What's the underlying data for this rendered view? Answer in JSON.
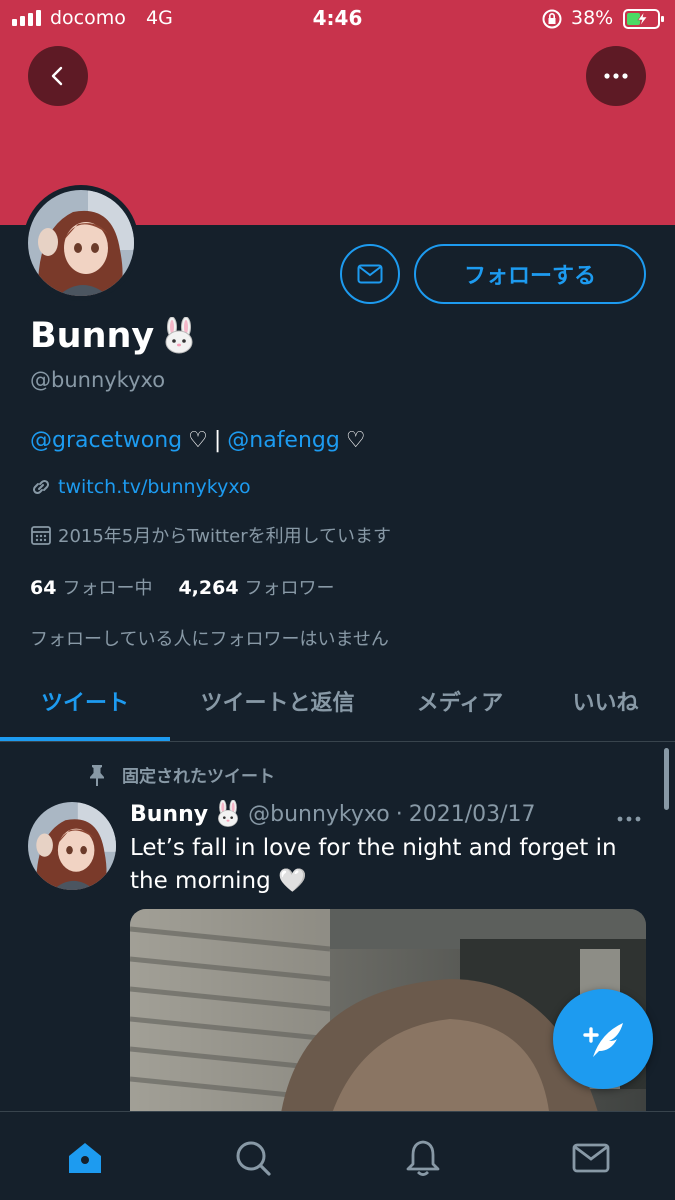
{
  "status_bar": {
    "carrier": "docomo",
    "network": "4G",
    "time": "4:46",
    "battery": "38%"
  },
  "profile": {
    "name": "Bunny",
    "name_emoji": "rabbit-face-icon",
    "handle": "@bunnykyxo",
    "follow_label": "フォローする",
    "bio": {
      "mention_1": "@gracetwong",
      "heart_1": "♡",
      "separator": "|",
      "mention_2": "@nafengg",
      "heart_2": "♡"
    },
    "link": "twitch.tv/bunnykyxo",
    "joined": "2015年5月からTwitterを利用しています",
    "following_count": "64",
    "following_label": "フォロー中",
    "followers_count": "4,264",
    "followers_label": "フォロワー",
    "mutual_note": "フォローしている人にフォロワーはいません"
  },
  "tabs": [
    {
      "label": "ツイート",
      "active": true
    },
    {
      "label": "ツイートと返信",
      "active": false
    },
    {
      "label": "メディア",
      "active": false
    },
    {
      "label": "いいね",
      "active": false
    }
  ],
  "tweet": {
    "pinned_label": "固定されたツイート",
    "name": "Bunny",
    "handle": "@bunnykyxo",
    "dot": "·",
    "date": "2021/03/17",
    "text": "Let’s fall in love for the night and forget in the morning 🤍"
  },
  "colors": {
    "banner": "#c8334c",
    "background": "#15202b",
    "accent": "#1d9bf0",
    "muted": "#8899a6"
  },
  "nav": [
    "home-icon",
    "search-icon",
    "bell-icon",
    "mail-icon"
  ]
}
